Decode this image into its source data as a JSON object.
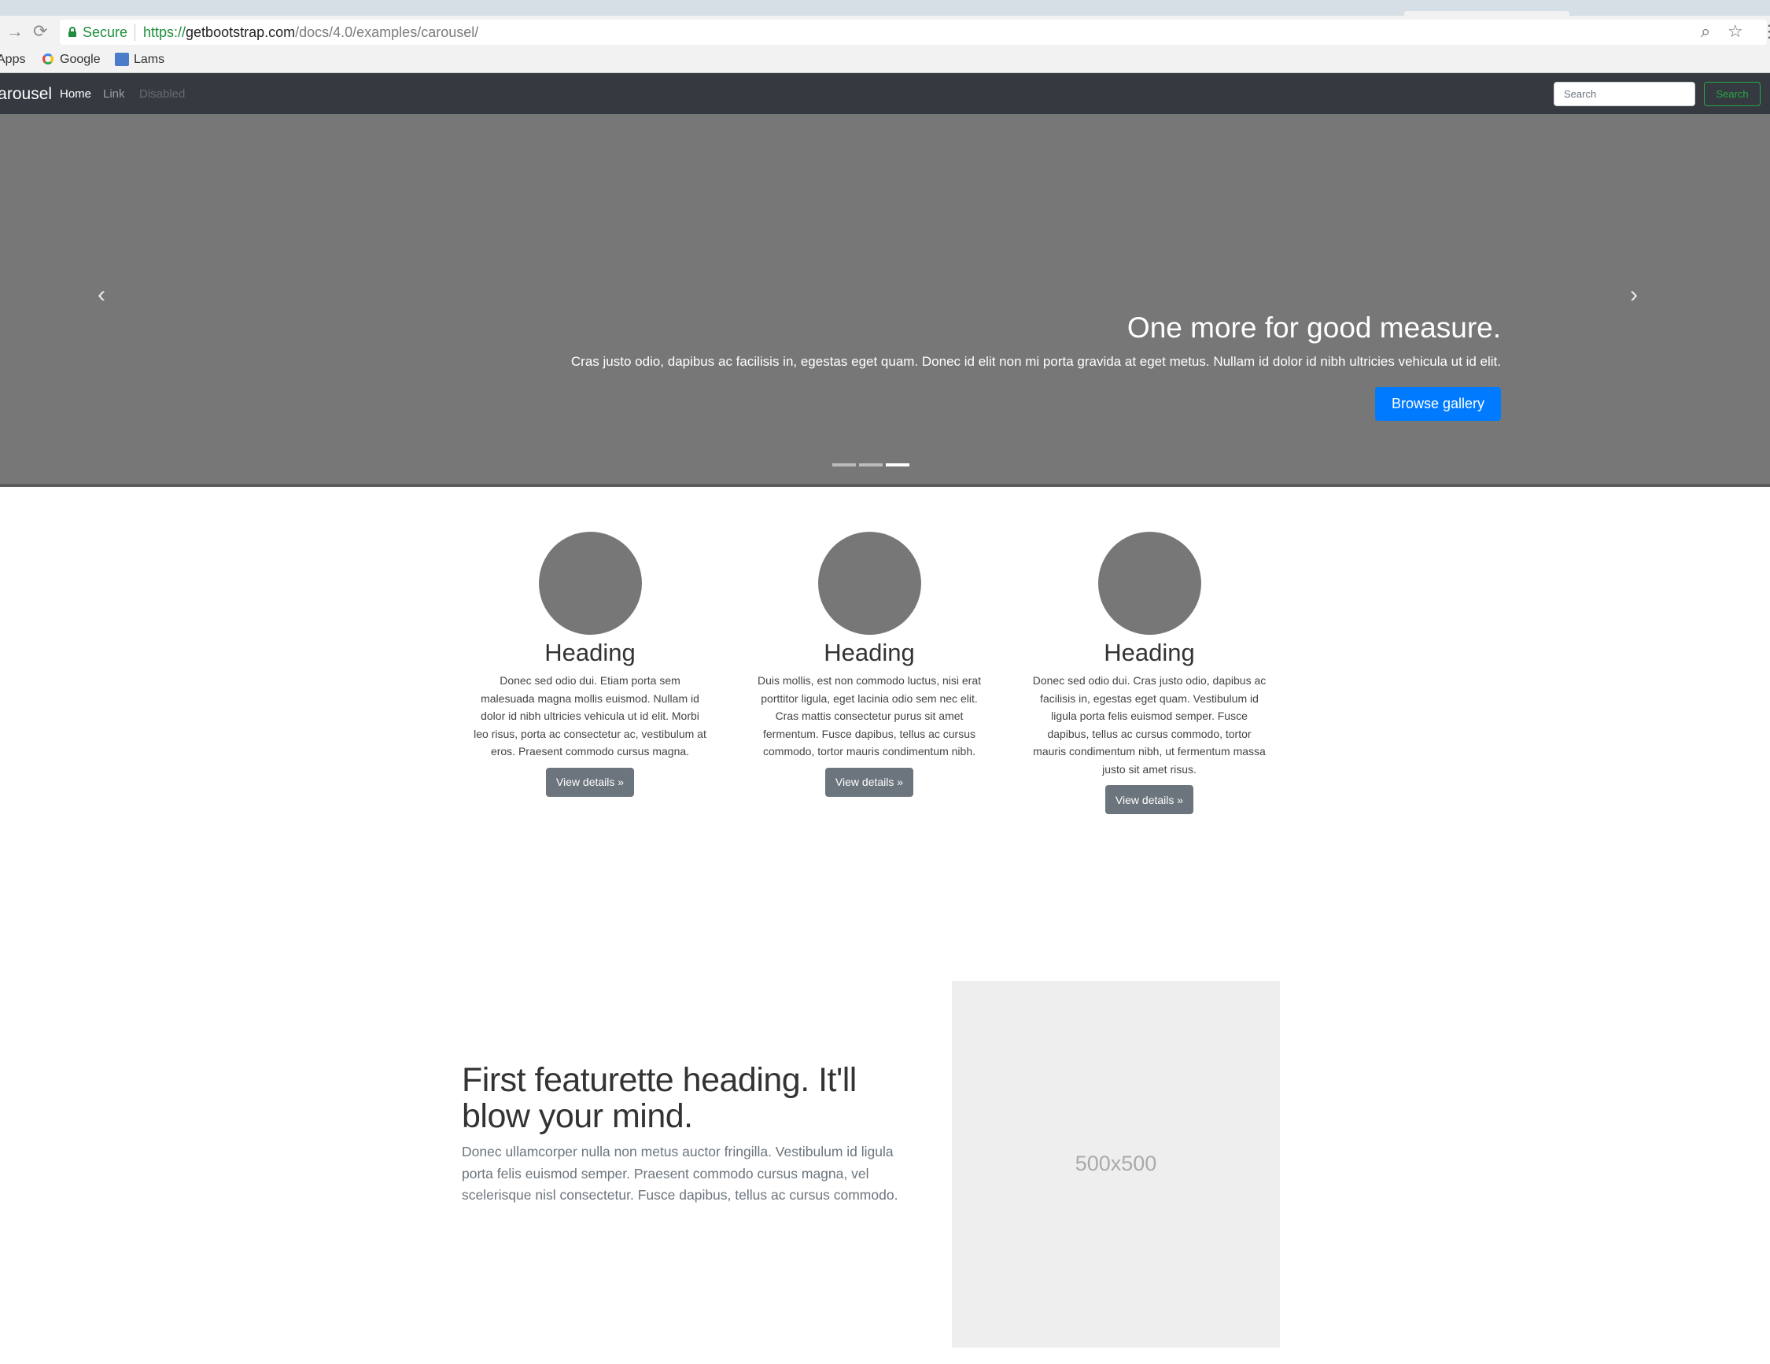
{
  "browser": {
    "secure_label": "Secure",
    "url_protocol": "https://",
    "url_host": "getbootstrap.com",
    "url_path": "/docs/4.0/examples/carousel/",
    "bookmarks": {
      "apps": "Apps",
      "google": "Google",
      "third": "Lams"
    }
  },
  "navbar": {
    "brand": "Carousel",
    "links": [
      "Home",
      "Link",
      "Disabled"
    ],
    "search_placeholder": "Search",
    "search_button": "Search",
    "colors": {
      "background": "#343a40",
      "search_button": "#28a745"
    }
  },
  "carousel": {
    "title": "One more for good measure.",
    "text": "Cras justo odio, dapibus ac facilisis in, egestas eget quam. Donec id elit non mi porta gravida at eget metus. Nullam id dolor id nibh ultricies vehicula ut id elit.",
    "button": "Browse gallery",
    "prev_icon": "chevron-left-icon",
    "next_icon": "chevron-right-icon",
    "slide_count": 3,
    "active_slide": 3,
    "colors": {
      "slide_background": "#777777",
      "primary_button": "#007bff"
    }
  },
  "marketing": {
    "columns": [
      {
        "heading": "Heading",
        "text": "Donec sed odio dui. Etiam porta sem malesuada magna mollis euismod. Nullam id dolor id nibh ultricies vehicula ut id elit. Morbi leo risus, porta ac consectetur ac, vestibulum at eros. Praesent commodo cursus magna.",
        "button": "View details »"
      },
      {
        "heading": "Heading",
        "text": "Duis mollis, est non commodo luctus, nisi erat porttitor ligula, eget lacinia odio sem nec elit. Cras mattis consectetur purus sit amet fermentum. Fusce dapibus, tellus ac cursus commodo, tortor mauris condimentum nibh.",
        "button": "View details »"
      },
      {
        "heading": "Heading",
        "text": "Donec sed odio dui. Cras justo odio, dapibus ac facilisis in, egestas eget quam. Vestibulum id ligula porta felis euismod semper. Fusce dapibus, tellus ac cursus commodo, tortor mauris condimentum nibh, ut fermentum massa justo sit amet risus.",
        "button": "View details »"
      }
    ]
  },
  "featurette": {
    "heading": "First featurette heading. It'll blow your mind.",
    "text": "Donec ullamcorper nulla non metus auctor fringilla. Vestibulum id ligula porta felis euismod semper. Praesent commodo cursus magna, vel scelerisque nisl consectetur. Fusce dapibus, tellus ac cursus commodo.",
    "image_label": "500x500"
  }
}
